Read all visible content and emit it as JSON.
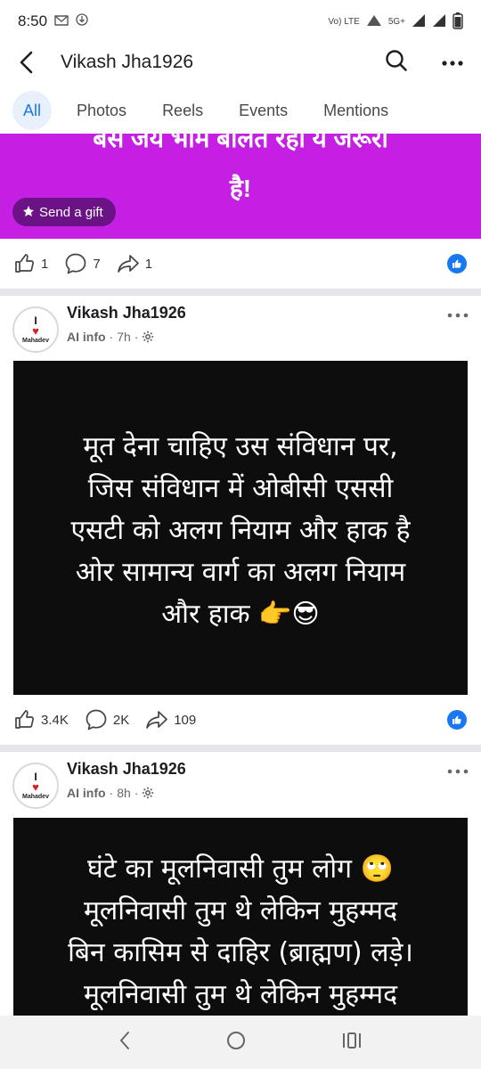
{
  "status": {
    "time": "8:50",
    "network": "5G+",
    "lte": "Vo) LTE"
  },
  "header": {
    "title": "Vikash Jha1926"
  },
  "tabs": [
    {
      "label": "All",
      "active": true
    },
    {
      "label": "Photos",
      "active": false
    },
    {
      "label": "Reels",
      "active": false
    },
    {
      "label": "Events",
      "active": false
    },
    {
      "label": "Mentions",
      "active": false
    }
  ],
  "banner": {
    "line1": "बस जय भीम बोलते रहो ये जरूरी",
    "line2": "है!",
    "gift_label": "Send a gift",
    "color": "#c41fe2"
  },
  "post0": {
    "likes": "1",
    "comments": "7",
    "shares": "1"
  },
  "post1": {
    "author": "Vikash Jha1926",
    "meta_label": "AI info",
    "time": "7h",
    "avatar_text": "Mahadev",
    "lines": [
      "मूत देना चाहिए उस संविधान पर,",
      "जिस संविधान  में ओबीसी एससी",
      "एसटी को अलग नियाम और हाक है",
      "ओर  सामान्य वार्ग  का अलग नियाम",
      "और हाक 👉😎"
    ],
    "likes": "3.4K",
    "comments": "2K",
    "shares": "109"
  },
  "post2": {
    "author": "Vikash Jha1926",
    "meta_label": "AI info",
    "time": "8h",
    "avatar_text": "Mahadev",
    "lines": [
      "घंटे का मूलनिवासी तुम लोग 🙄",
      "मूलनिवासी तुम थे लेकिन मुहम्मद",
      "बिन कासिम से दाहिर (ब्राह्मण) लड़े।",
      "मूलनिवासी तुम थे लेकिन मुहम्मद"
    ]
  },
  "colors": {
    "accent": "#1877f2",
    "active_tab_bg": "#e7f0fb"
  }
}
